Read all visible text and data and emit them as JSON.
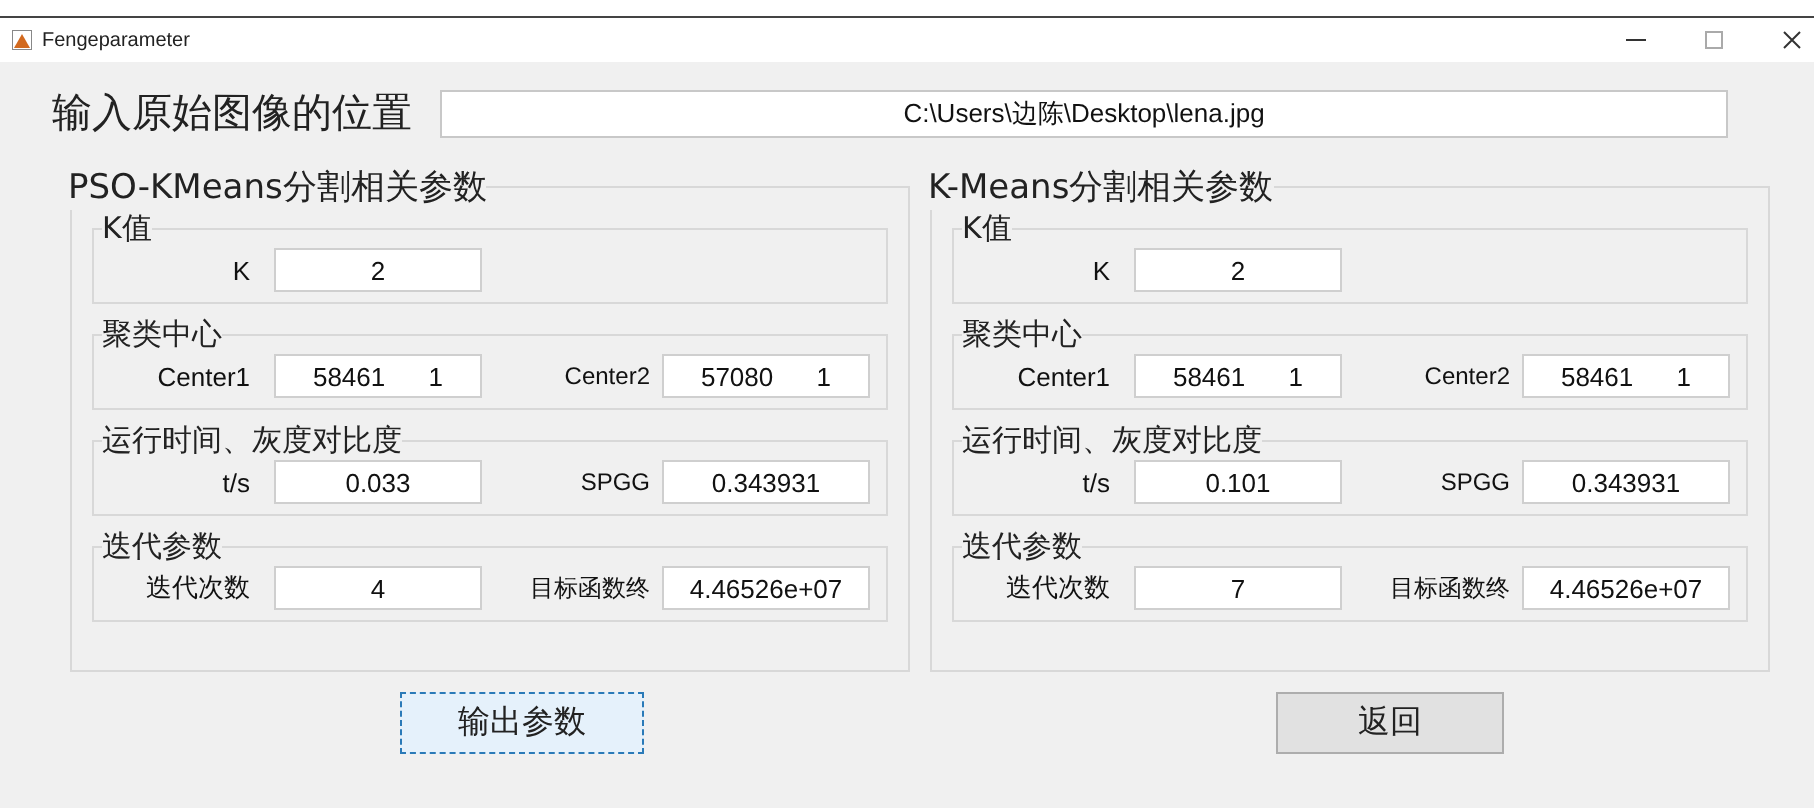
{
  "window": {
    "title": "Fengeparameter"
  },
  "image_path": {
    "label": "输入原始图像的位置",
    "value": "C:\\Users\\边陈\\Desktop\\lena.jpg"
  },
  "panels": [
    {
      "title": "PSO-KMeans分割相关参数",
      "groups": [
        {
          "title": "K值",
          "fields": [
            {
              "label": "K",
              "value": "2"
            }
          ]
        },
        {
          "title": "聚类中心",
          "fields": [
            {
              "label": "Center1",
              "value": "58461      1"
            },
            {
              "label": "Center2",
              "value": "57080      1"
            }
          ]
        },
        {
          "title": "运行时间、灰度对比度",
          "fields": [
            {
              "label": "t/s",
              "value": "0.033"
            },
            {
              "label": "SPGG",
              "value": "0.343931"
            }
          ]
        },
        {
          "title": "迭代参数",
          "fields": [
            {
              "label": "迭代次数",
              "value": "4"
            },
            {
              "label": "目标函数终",
              "value": "4.46526e+07"
            }
          ]
        }
      ]
    },
    {
      "title": "K-Means分割相关参数",
      "groups": [
        {
          "title": "K值",
          "fields": [
            {
              "label": "K",
              "value": "2"
            }
          ]
        },
        {
          "title": "聚类中心",
          "fields": [
            {
              "label": "Center1",
              "value": "58461      1"
            },
            {
              "label": "Center2",
              "value": "58461      1"
            }
          ]
        },
        {
          "title": "运行时间、灰度对比度",
          "fields": [
            {
              "label": "t/s",
              "value": "0.101"
            },
            {
              "label": "SPGG",
              "value": "0.343931"
            }
          ]
        },
        {
          "title": "迭代参数",
          "fields": [
            {
              "label": "迭代次数",
              "value": "7"
            },
            {
              "label": "目标函数终",
              "value": "4.46526e+07"
            }
          ]
        }
      ]
    }
  ],
  "buttons": [
    {
      "label": "输出参数",
      "focused": true
    },
    {
      "label": "返回",
      "focused": false
    }
  ]
}
